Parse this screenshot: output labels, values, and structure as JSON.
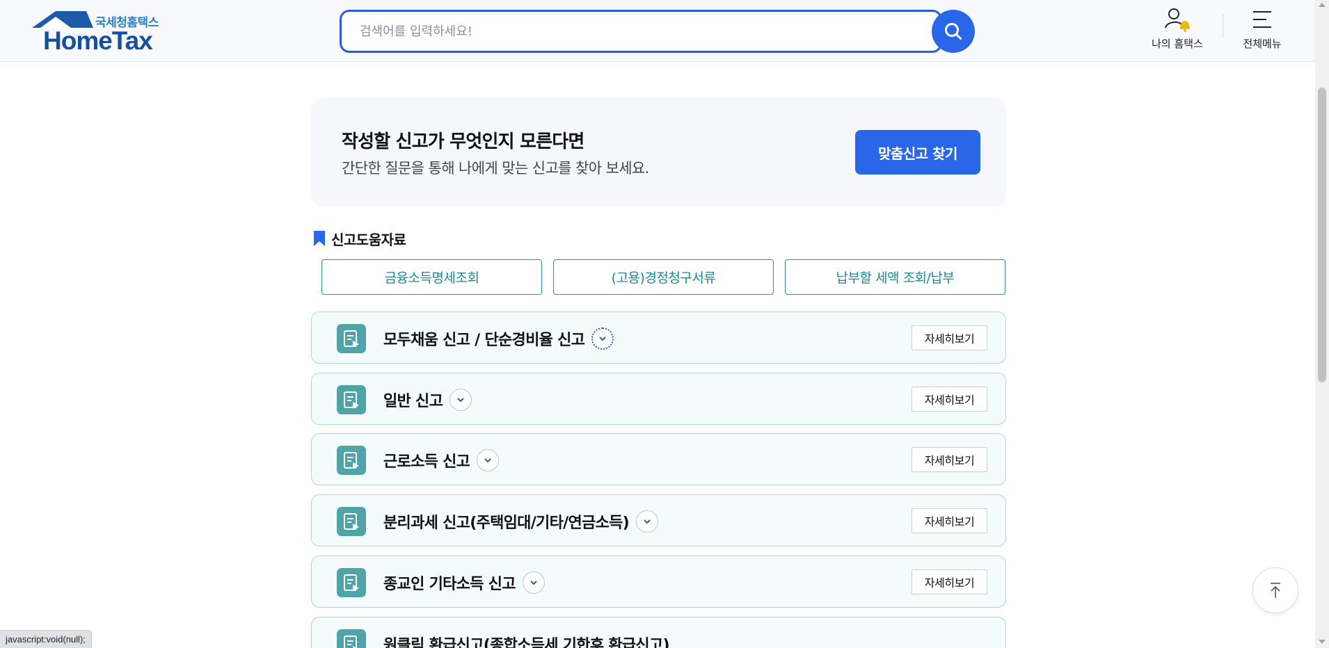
{
  "header": {
    "logo_sub": "국세청홈택스",
    "logo_main": "HomeTax",
    "search_placeholder": "검색어를 입력하세요!",
    "my_hometax_label": "나의 홈택스",
    "all_menu_label": "전체메뉴"
  },
  "banner": {
    "title": "작성할 신고가 무엇인지 모른다면",
    "desc": "간단한 질문을 통해 나에게 맞는 신고를 찾아 보세요.",
    "button": "맞춤신고 찾기"
  },
  "help": {
    "title": "신고도움자료",
    "buttons": [
      "금융소득명세조회",
      "(고용)경정청구서류",
      "납부할 세액 조회/납부"
    ]
  },
  "list": {
    "more_label": "자세히보기",
    "items": [
      {
        "title": "모두채움 신고 / 단순경비율 신고"
      },
      {
        "title": "일반 신고"
      },
      {
        "title": "근로소득 신고"
      },
      {
        "title": "분리과세 신고(주택임대/기타/연금소득)"
      },
      {
        "title": "종교인 기타소득 신고"
      },
      {
        "title": "원클릭 환급신고(종합소득세 기한후 환급신고)"
      }
    ]
  },
  "status_bar": "javascript:void(null);",
  "colors": {
    "primary": "#2a67e8",
    "teal": "#2b8f9d",
    "logo_blue": "#14509e",
    "card_bg": "#f3fbfb",
    "card_border": "#a9d8dc"
  },
  "icons": {
    "search": "search-icon",
    "my_hometax": "user-bell-icon",
    "menu": "hamburger-icon",
    "bookmark": "bookmark-icon",
    "doc": "document-edit-icon",
    "chevron": "chevron-down-icon",
    "to_top": "arrow-up-icon"
  }
}
